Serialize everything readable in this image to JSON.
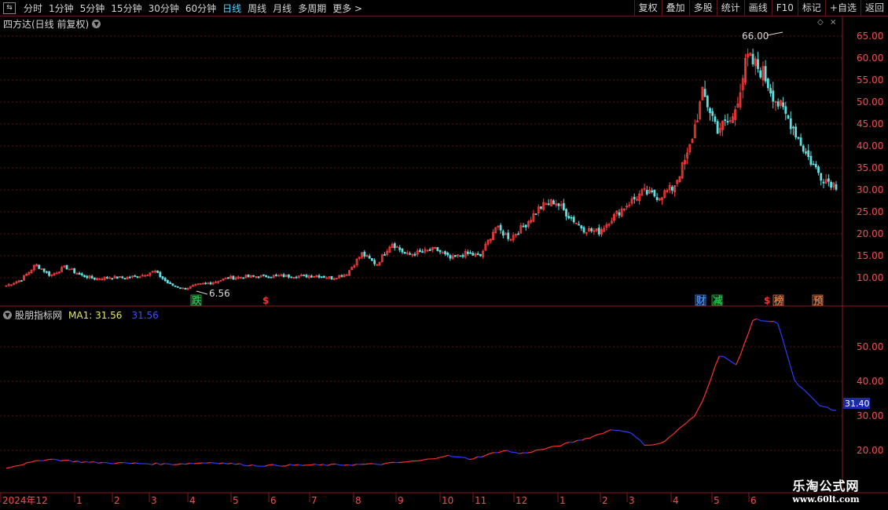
{
  "toolbar": {
    "box_label": "⇆",
    "periods": [
      "分时",
      "1分钟",
      "5分钟",
      "15分钟",
      "30分钟",
      "60分钟",
      "日线",
      "周线",
      "月线",
      "多周期",
      "更多 >"
    ],
    "active_period": "日线",
    "right_buttons": [
      "复权",
      "叠加",
      "多股",
      "统计",
      "画线",
      "F10",
      "标记",
      "+自选",
      "返回"
    ]
  },
  "main_chart": {
    "title": "四方达(日线 前复权)",
    "max_label": "66.00",
    "min_label": "6.56",
    "y_ticks": [
      "65.00",
      "60.00",
      "55.00",
      "50.00",
      "45.00",
      "40.00",
      "35.00",
      "30.00",
      "25.00",
      "20.00",
      "15.00",
      "10.00"
    ],
    "markers": [
      {
        "text": "跌",
        "color": "#23c14a"
      },
      {
        "text": "$",
        "color": "#ff3030"
      },
      {
        "text": "财",
        "color": "#3a8cff"
      },
      {
        "text": "减",
        "color": "#23c14a"
      },
      {
        "text": "$",
        "color": "#ff3030"
      },
      {
        "text": "榜",
        "color": "#d9743a"
      },
      {
        "text": "预",
        "color": "#d9743a"
      }
    ]
  },
  "indicator": {
    "name": "股朋指标网",
    "ma_label": "MA1: 31.56",
    "value_blue": "31.56",
    "last_value_tag": "31.40",
    "y_ticks": [
      "50.00",
      "40.00",
      "30.00",
      "20.00"
    ]
  },
  "x_axis": {
    "labels": [
      "2024年12",
      "1",
      "2",
      "3",
      "4",
      "5",
      "6",
      "7",
      "8",
      "9",
      "10",
      "11",
      "12",
      "1",
      "2",
      "3",
      "4",
      "5",
      "6"
    ]
  },
  "watermark": {
    "line1": "乐淘公式网",
    "line2": "www.60lt.com"
  },
  "colors": {
    "up": "#ff3b3b",
    "down": "#5fe0e0",
    "grid": "#5a1010",
    "axis_text": "#ff4a4a",
    "ma_up": "#ff3030",
    "ma_down": "#2a3cff",
    "active": "#56d8ff"
  },
  "chart_data": {
    "type": "candlestick",
    "title": "四方达(日线 前复权)",
    "ylim": [
      5,
      68
    ],
    "max": 66.0,
    "min": 6.56,
    "close_path": [
      [
        "2024-12",
        8.2
      ],
      [
        "2024-12",
        9.5
      ],
      [
        "2024-12",
        13.0
      ],
      [
        "2025-01",
        10.5
      ],
      [
        "2025-01",
        12.5
      ],
      [
        "2025-01",
        10.6
      ],
      [
        "2025-02",
        9.8
      ],
      [
        "2025-02",
        10.1
      ],
      [
        "2025-03",
        10.0
      ],
      [
        "2025-03",
        10.4
      ],
      [
        "2025-04",
        11.5
      ],
      [
        "2025-04",
        8.5
      ],
      [
        "2025-04",
        7.5
      ],
      [
        "2025-05",
        8.4
      ],
      [
        "2025-05",
        9.0
      ],
      [
        "2025-06",
        10.0
      ],
      [
        "2025-06",
        10.2
      ],
      [
        "2025-07",
        10.3
      ],
      [
        "2025-07",
        10.4
      ],
      [
        "2025-08",
        10.4
      ],
      [
        "2025-08",
        10.4
      ],
      [
        "2025-09",
        10.5
      ],
      [
        "2025-09",
        9.9
      ],
      [
        "2025-10",
        11.0
      ],
      [
        "2025-10",
        15.5
      ],
      [
        "2025-11",
        13.0
      ],
      [
        "2025-11",
        18.0
      ],
      [
        "2025-11",
        15.2
      ],
      [
        "2025-12",
        15.8
      ],
      [
        "2025-12",
        16.5
      ],
      [
        "2026-01",
        14.3
      ],
      [
        "2026-01",
        15.5
      ],
      [
        "2026-01",
        15.0
      ],
      [
        "2026-02",
        21.5
      ],
      [
        "2026-02",
        19.0
      ],
      [
        "2026-02",
        22.0
      ],
      [
        "2026-03",
        26.0
      ],
      [
        "2026-03",
        27.5
      ],
      [
        "2026-03",
        24.0
      ],
      [
        "2026-04",
        21.0
      ],
      [
        "2026-04",
        20.5
      ],
      [
        "2026-04",
        24.0
      ],
      [
        "2026-05",
        27.0
      ],
      [
        "2026-05",
        29.5
      ],
      [
        "2026-05",
        28.5
      ],
      [
        "2026-05",
        30.5
      ],
      [
        "2026-06",
        38.0
      ],
      [
        "2026-06",
        52.0
      ],
      [
        "2026-06",
        44.0
      ],
      [
        "2026-06",
        46.0
      ],
      [
        "2026-06",
        60.0
      ],
      [
        "2026-06",
        57.0
      ],
      [
        "2026-06",
        50.0
      ],
      [
        "2026-06",
        45.0
      ],
      [
        "2026-06",
        38.0
      ],
      [
        "2026-06",
        33.0
      ],
      [
        "2026-06",
        31.0
      ]
    ],
    "indicator": {
      "name": "MA1",
      "last": 31.56,
      "ylim": [
        14,
        62
      ],
      "path": [
        [
          0,
          15.0
        ],
        [
          0.05,
          17.5
        ],
        [
          0.1,
          16.5
        ],
        [
          0.2,
          16.0
        ],
        [
          0.25,
          16.5
        ],
        [
          0.3,
          15.6
        ],
        [
          0.4,
          15.8
        ],
        [
          0.45,
          16.0
        ],
        [
          0.5,
          17.0
        ],
        [
          0.53,
          18.5
        ],
        [
          0.56,
          17.5
        ],
        [
          0.6,
          20.0
        ],
        [
          0.62,
          19.0
        ],
        [
          0.66,
          21.0
        ],
        [
          0.7,
          23.5
        ],
        [
          0.73,
          26.0
        ],
        [
          0.75,
          25.5
        ],
        [
          0.77,
          21.5
        ],
        [
          0.79,
          22.0
        ],
        [
          0.83,
          30.0
        ],
        [
          0.84,
          35.0
        ],
        [
          0.86,
          48.0
        ],
        [
          0.88,
          44.5
        ],
        [
          0.9,
          58.0
        ],
        [
          0.93,
          57.0
        ],
        [
          0.95,
          40.0
        ],
        [
          0.98,
          33.0
        ],
        [
          1.0,
          31.4
        ]
      ]
    }
  }
}
